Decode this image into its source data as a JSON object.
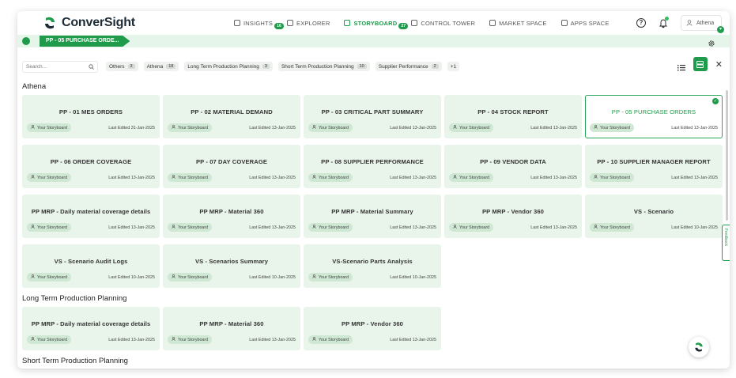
{
  "app": {
    "name": "ConverSight"
  },
  "nav": [
    {
      "label": "INSIGHTS",
      "icon": "insights-icon",
      "badge": "16",
      "active": false
    },
    {
      "label": "EXPLORER",
      "icon": "binoculars-icon",
      "badge": "",
      "active": false
    },
    {
      "label": "STORYBOARD",
      "icon": "storyboard-icon",
      "badge": "27",
      "active": true
    },
    {
      "label": "CONTROL TOWER",
      "icon": "tower-icon",
      "badge": "",
      "active": false
    },
    {
      "label": "MARKET SPACE",
      "icon": "market-icon",
      "badge": "",
      "active": false
    },
    {
      "label": "APPS SPACE",
      "icon": "apps-grid-icon",
      "badge": "",
      "active": false
    }
  ],
  "user": {
    "name": "Athena"
  },
  "breadcrumb": {
    "current": "PP - 05 PURCHASE ORDE..."
  },
  "search": {
    "placeholder": "Search..."
  },
  "filters": [
    {
      "label": "Others",
      "count": "3"
    },
    {
      "label": "Athena",
      "count": "18"
    },
    {
      "label": "Long Term Production Planning",
      "count": "3"
    },
    {
      "label": "Short Term Production Planning",
      "count": "10"
    },
    {
      "label": "Supplier Performance",
      "count": "2"
    },
    {
      "label": "+1",
      "count": ""
    }
  ],
  "feedback_label": "Feedback",
  "colors": {
    "accent": "#1f9b4b",
    "card_bg": "#e9f5ea",
    "tag_bg": "#cfe8d4"
  },
  "sections": [
    {
      "title": "Athena",
      "cards": [
        {
          "title": "PP - 01 MES ORDERS",
          "tag": "Your Storyboard",
          "edited": "Last Edited 31-Jan-2025",
          "selected": false
        },
        {
          "title": "PP - 02 MATERIAL DEMAND",
          "tag": "Your Storyboard",
          "edited": "Last Edited 13-Jan-2025",
          "selected": false
        },
        {
          "title": "PP - 03 CRITICAL PART SUMMARY",
          "tag": "Your Storyboard",
          "edited": "Last Edited 13-Jan-2025",
          "selected": false
        },
        {
          "title": "PP - 04 STOCK REPORT",
          "tag": "Your Storyboard",
          "edited": "Last Edited 13-Jan-2025",
          "selected": false
        },
        {
          "title": "PP - 05 PURCHASE ORDERS",
          "tag": "Your Storyboard",
          "edited": "Last Edited 13-Jan-2025",
          "selected": true
        },
        {
          "title": "PP - 06 ORDER COVERAGE",
          "tag": "Your Storyboard",
          "edited": "Last Edited 13-Jan-2025",
          "selected": false
        },
        {
          "title": "PP - 07 DAY COVERAGE",
          "tag": "Your Storyboard",
          "edited": "Last Edited 13-Jan-2025",
          "selected": false
        },
        {
          "title": "PP - 08 SUPPLIER PERFORMANCE",
          "tag": "Your Storyboard",
          "edited": "Last Edited 13-Jan-2025",
          "selected": false
        },
        {
          "title": "PP - 09 VENDOR DATA",
          "tag": "Your Storyboard",
          "edited": "Last Edited 13-Jan-2025",
          "selected": false
        },
        {
          "title": "PP - 10 SUPPLIER MANAGER REPORT",
          "tag": "Your Storyboard",
          "edited": "Last Edited 13-Jan-2025",
          "selected": false
        },
        {
          "title": "PP MRP - Daily material coverage details",
          "tag": "Your Storyboard",
          "edited": "Last Edited 13-Jan-2025",
          "selected": false
        },
        {
          "title": "PP MRP - Material 360",
          "tag": "Your Storyboard",
          "edited": "Last Edited 13-Jan-2025",
          "selected": false
        },
        {
          "title": "PP MRP - Material Summary",
          "tag": "Your Storyboard",
          "edited": "Last Edited 13-Jan-2025",
          "selected": false
        },
        {
          "title": "PP MRP - Vendor 360",
          "tag": "Your Storyboard",
          "edited": "Last Edited 13-Jan-2025",
          "selected": false
        },
        {
          "title": "VS - Scenario",
          "tag": "Your Storyboard",
          "edited": "Last Edited 10-Jan-2025",
          "selected": false
        },
        {
          "title": "VS - Scenario Audit Logs",
          "tag": "Your Storyboard",
          "edited": "Last Edited 10-Jan-2025",
          "selected": false
        },
        {
          "title": "VS - Scenarios Summary",
          "tag": "Your Storyboard",
          "edited": "Last Edited 10-Jan-2025",
          "selected": false
        },
        {
          "title": "VS-Scenario Parts Analysis",
          "tag": "Your Storyboard",
          "edited": "Last Edited 10-Jan-2025",
          "selected": false
        }
      ]
    },
    {
      "title": "Long Term Production Planning",
      "cards": [
        {
          "title": "PP MRP - Daily material coverage details",
          "tag": "Your Storyboard",
          "edited": "Last Edited 13-Jan-2025",
          "selected": false
        },
        {
          "title": "PP MRP - Material 360",
          "tag": "Your Storyboard",
          "edited": "Last Edited 13-Jan-2025",
          "selected": false
        },
        {
          "title": "PP MRP - Vendor 360",
          "tag": "Your Storyboard",
          "edited": "Last Edited 13-Jan-2025",
          "selected": false
        }
      ]
    },
    {
      "title": "Short Term Production Planning",
      "cards": []
    }
  ]
}
